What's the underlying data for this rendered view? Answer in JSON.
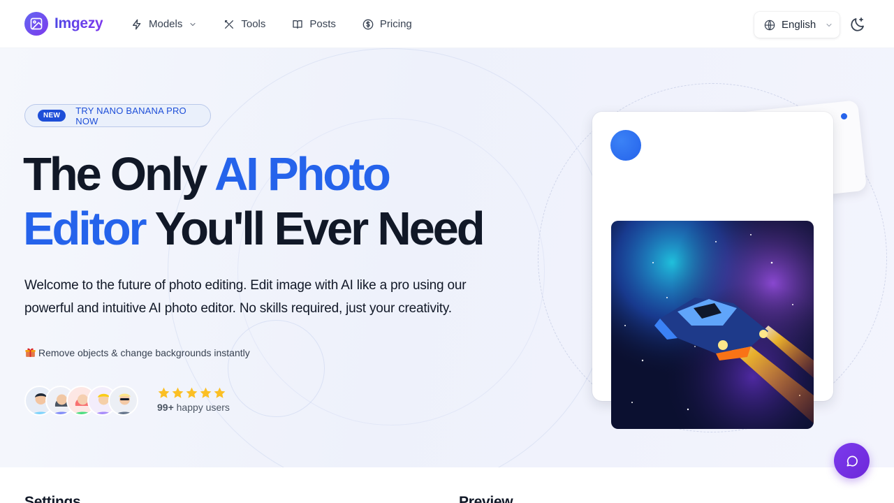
{
  "brand": {
    "name": "Imgezy"
  },
  "nav": {
    "links": [
      {
        "label": "Models",
        "icon": "bolt-icon",
        "has_dropdown": true
      },
      {
        "label": "Tools",
        "icon": "tools-icon",
        "has_dropdown": false
      },
      {
        "label": "Posts",
        "icon": "book-icon",
        "has_dropdown": false
      },
      {
        "label": "Pricing",
        "icon": "dollar-circle-icon",
        "has_dropdown": false
      }
    ],
    "language": "English",
    "theme_toggle_icon": "moon-sparkle-icon"
  },
  "hero": {
    "badge": {
      "tag": "NEW",
      "text": "TRY NANO BANANA PRO NOW"
    },
    "headline": {
      "part1": "The Only ",
      "part2_highlight": "AI Photo Editor",
      "part2_line1": "AI Photo",
      "part2_line2": "Editor",
      "part3": " You'll Ever Need"
    },
    "lead": "Welcome to the future of photo editing. Edit image with AI like a pro using our powerful and intuitive AI photo editor. No skills required, just your creativity.",
    "feature": "Remove objects & change backgrounds instantly",
    "rating": {
      "stars": 5,
      "count": "99+",
      "label": "happy users"
    }
  },
  "sections": {
    "settings_title": "Settings",
    "preview_title": "Preview"
  },
  "colors": {
    "accent": "#2563eb",
    "brand_purple": "#7c3aed",
    "star": "#fbbf24"
  }
}
